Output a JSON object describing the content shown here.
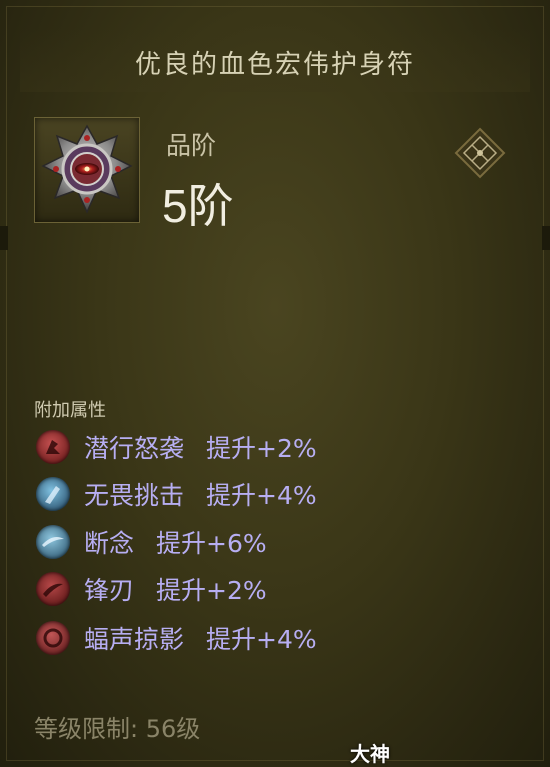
{
  "item": {
    "title": "优良的血色宏伟护身符",
    "grade_label": "品阶",
    "grade_value": "5阶",
    "icon": "amulet-icon",
    "compare_icon": "compare-diamond-icon"
  },
  "attributes": {
    "section_label": "附加属性",
    "rows": [
      {
        "name": "潜行怒袭",
        "value": "提升+2%",
        "icon": "red-skill-icon",
        "color": "#8c2323"
      },
      {
        "name": "无畏挑击",
        "value": "提升+4%",
        "icon": "blue-skill-icon",
        "color": "#2f6f95"
      },
      {
        "name": "断念",
        "value": "提升+6%",
        "icon": "blue-skill-icon",
        "color": "#4d86a8"
      },
      {
        "name": "锋刃",
        "value": "提升+2%",
        "icon": "red-skill-icon",
        "color": "#8a2727"
      },
      {
        "name": "蝠声掠影",
        "value": "提升+4%",
        "icon": "red-skill-icon",
        "color": "#93302e"
      }
    ]
  },
  "footer": {
    "level_requirement": "等级限制: 56级"
  },
  "watermark": "大神"
}
